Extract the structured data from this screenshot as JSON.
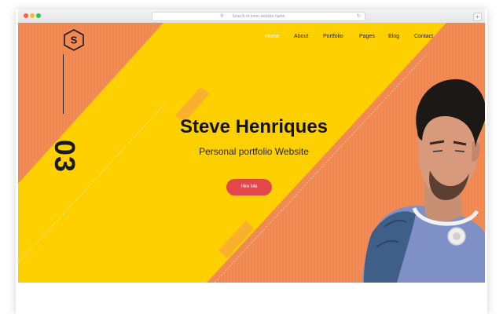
{
  "browser": {
    "url_placeholder": "Search or enter website name",
    "search_icon": "magnifier-icon",
    "reload_icon": "reload-icon",
    "new_tab_icon": "plus-icon"
  },
  "site": {
    "logo_letter": "S",
    "nav": [
      {
        "label": "Home",
        "active": true
      },
      {
        "label": "About",
        "active": false
      },
      {
        "label": "Portfolio",
        "active": false
      },
      {
        "label": "Pages",
        "active": false
      },
      {
        "label": "Blog",
        "active": false
      },
      {
        "label": "Contact",
        "active": false
      }
    ]
  },
  "hero": {
    "slide_number": "03",
    "title": "Steve Henriques",
    "subtitle": "Personal portfolio Website",
    "cta_label": "Hire Me"
  },
  "colors": {
    "orange": "#f28a54",
    "yellow": "#ffd000",
    "cta_red": "#e2474a",
    "nav_active": "#ffffff"
  }
}
